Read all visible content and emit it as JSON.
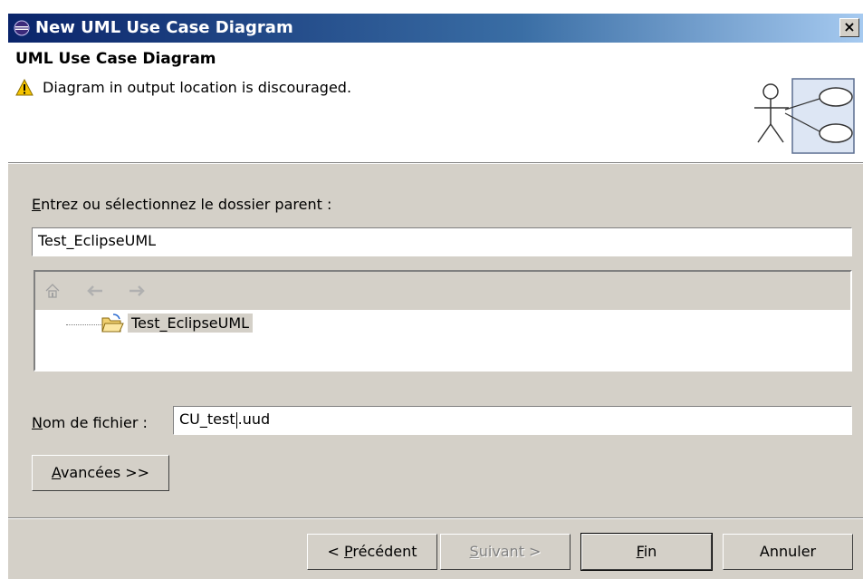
{
  "window": {
    "title": "New UML Use Case Diagram",
    "close_label": "×"
  },
  "header": {
    "title": "UML Use Case Diagram",
    "message": "Diagram in output location is discouraged.",
    "message_icon": "warning-icon",
    "banner_icon": "use-case-diagram-icon"
  },
  "parent": {
    "label_access_key": "E",
    "label_rest": "ntrez ou sélectionnez le dossier parent :",
    "value": "Test_EclipseUML"
  },
  "tree": {
    "toolbar_icons": [
      "home-icon",
      "back-arrow-icon",
      "forward-arrow-icon"
    ],
    "items": [
      {
        "label": "Test_EclipseUML",
        "icon": "open-folder-icon",
        "selected": true
      }
    ]
  },
  "filename": {
    "label_access_key": "N",
    "label_rest": "om de fichier :",
    "value_before_cursor": "CU_test",
    "value_after_cursor": ".uud"
  },
  "advanced": {
    "access_key": "A",
    "rest": "vancées >>"
  },
  "buttons": {
    "back": {
      "prefix": "< ",
      "access_key": "P",
      "rest": "récédent"
    },
    "next": {
      "access_key": "S",
      "rest": "uivant >",
      "disabled": true
    },
    "finish": {
      "access_key": "F",
      "rest": "in"
    },
    "cancel": {
      "label": "Annuler"
    }
  },
  "colors": {
    "title_gradient_start": "#0a246a",
    "dialog_face": "#d4d0c8",
    "warning": "#f5c400"
  }
}
